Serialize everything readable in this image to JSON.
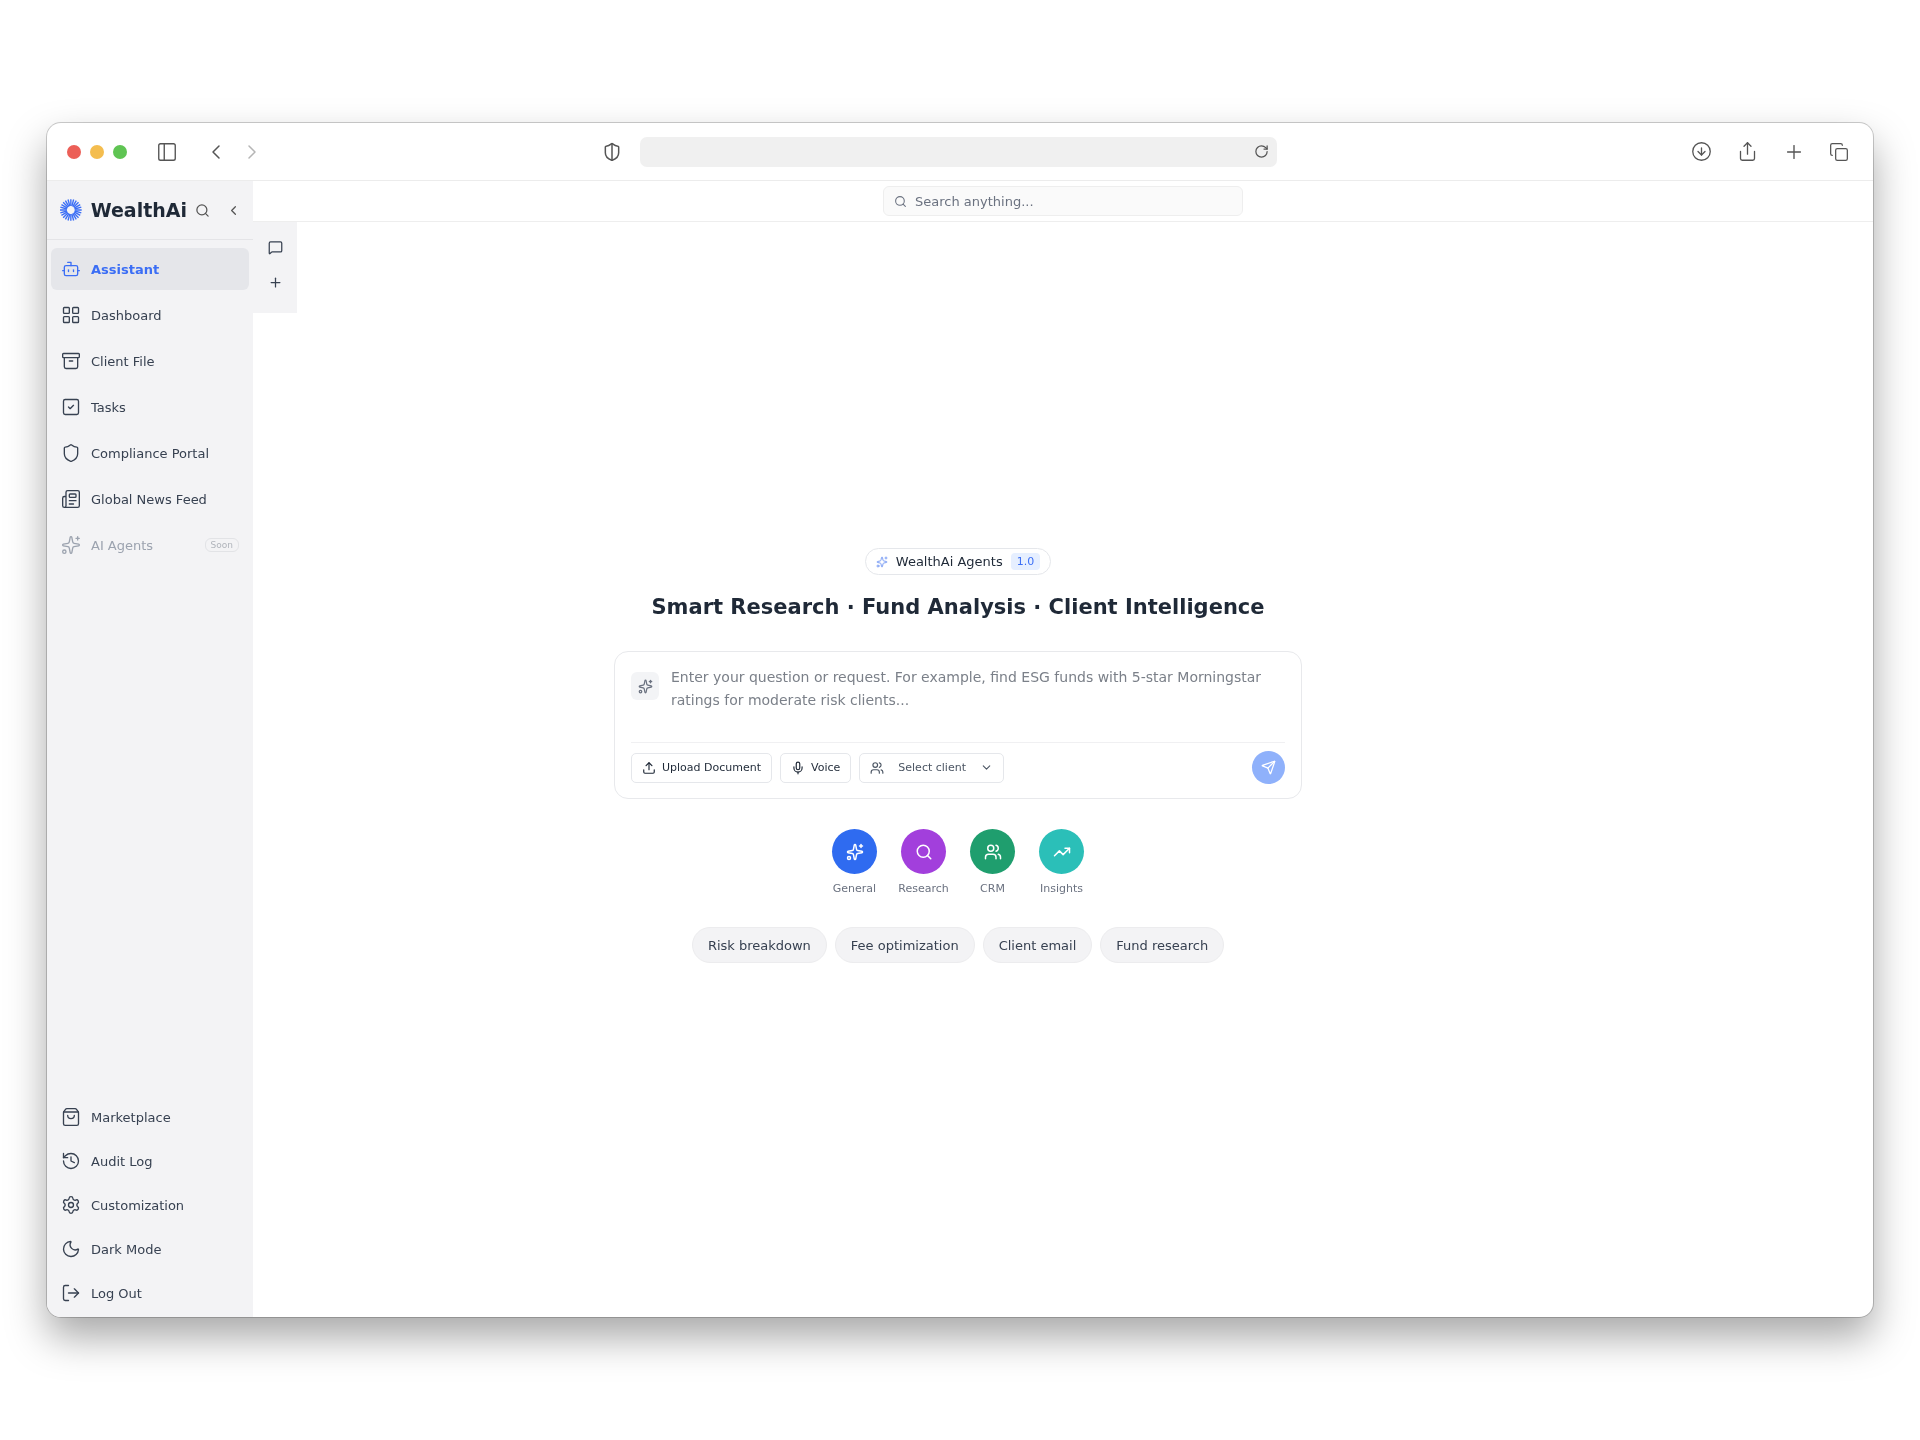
{
  "app": {
    "brand": "WealthAi"
  },
  "sidebar": {
    "items": [
      {
        "label": "Assistant",
        "selected": true,
        "disabled": false
      },
      {
        "label": "Dashboard",
        "selected": false,
        "disabled": false
      },
      {
        "label": "Client File",
        "selected": false,
        "disabled": false
      },
      {
        "label": "Tasks",
        "selected": false,
        "disabled": false
      },
      {
        "label": "Compliance Portal",
        "selected": false,
        "disabled": false
      },
      {
        "label": "Global News Feed",
        "selected": false,
        "disabled": false
      },
      {
        "label": "AI Agents",
        "selected": false,
        "disabled": true,
        "badge": "Soon"
      }
    ],
    "bottom_items": [
      {
        "label": "Marketplace"
      },
      {
        "label": "Audit Log"
      },
      {
        "label": "Customization"
      },
      {
        "label": "Dark Mode"
      },
      {
        "label": "Log Out"
      }
    ]
  },
  "search": {
    "placeholder": "Search anything..."
  },
  "agent_badge": {
    "label": "WealthAi Agents",
    "version": "1.0"
  },
  "headline": "Smart Research · Fund Analysis · Client Intelligence",
  "prompt": {
    "placeholder": "Enter your question or request. For example, find ESG funds with 5-star Morningstar ratings for moderate risk clients...",
    "actions": [
      {
        "kind": "button",
        "label": "Upload Document"
      },
      {
        "kind": "button",
        "label": "Voice"
      },
      {
        "kind": "dropdown",
        "label": "Select client"
      }
    ]
  },
  "modes": [
    {
      "label": "General",
      "color": "#2f6bf0"
    },
    {
      "label": "Research",
      "color": "#a23fdc"
    },
    {
      "label": "CRM",
      "color": "#1f9e6e"
    },
    {
      "label": "Insights",
      "color": "#2bbfb8"
    }
  ],
  "suggestions": [
    "Risk breakdown",
    "Fee optimization",
    "Client email",
    "Fund research"
  ]
}
